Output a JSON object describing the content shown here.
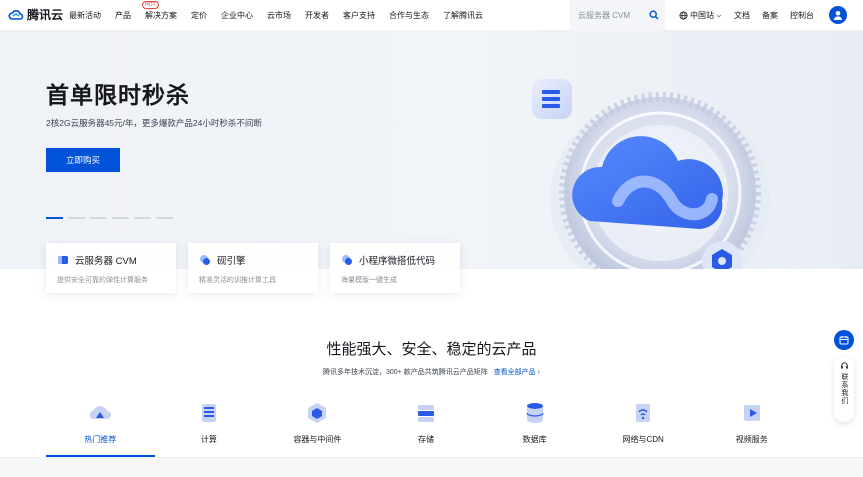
{
  "brand": {
    "name": "腾讯云"
  },
  "nav": {
    "links": [
      "最新活动",
      "产品",
      "解决方案",
      "定价",
      "企业中心",
      "云市场",
      "开发者",
      "客户支持",
      "合作与生态",
      "了解腾讯云"
    ],
    "hot_badge": "HOT",
    "search_placeholder": "云服务器 CVM",
    "region": "中国站",
    "right_items": [
      "文档",
      "备案",
      "控制台"
    ]
  },
  "hero": {
    "title": "首单限时秒杀",
    "subtitle": "2核2G云服务器45元/年，更多爆款产品24小时秒杀不间断",
    "cta": "立即购买",
    "carousel_count": 6,
    "carousel_active_index": 0
  },
  "cards": [
    {
      "title": "云服务器 CVM",
      "desc": "提供安全可靠的弹性计算服务",
      "icon": "cvm-icon"
    },
    {
      "title": "砚引擎",
      "desc": "精准灵活的训推计算工具",
      "icon": "engine-icon"
    },
    {
      "title": "小程序微搭低代码",
      "desc": "海量模版一键生成",
      "icon": "lowcode-icon"
    }
  ],
  "section": {
    "title": "性能强大、安全、稳定的云产品",
    "subtitle": "腾讯多年技术沉淀，300+ 款产品共筑腾讯云产品矩阵",
    "link": "查看全部产品 ›"
  },
  "tabs": [
    {
      "label": "热门推荐",
      "icon": "hot-recommend-icon",
      "active": true
    },
    {
      "label": "计算",
      "icon": "compute-icon",
      "active": false
    },
    {
      "label": "容器与中间件",
      "icon": "container-icon",
      "active": false
    },
    {
      "label": "存储",
      "icon": "storage-icon",
      "active": false
    },
    {
      "label": "数据库",
      "icon": "database-icon",
      "active": false
    },
    {
      "label": "网络与CDN",
      "icon": "network-icon",
      "active": false
    },
    {
      "label": "视频服务",
      "icon": "video-icon",
      "active": false
    }
  ],
  "side": {
    "contact_label": "联系我们"
  },
  "colors": {
    "brand_blue": "#0052d9",
    "hot_red": "#e8443a",
    "text_dark": "#16181d"
  }
}
